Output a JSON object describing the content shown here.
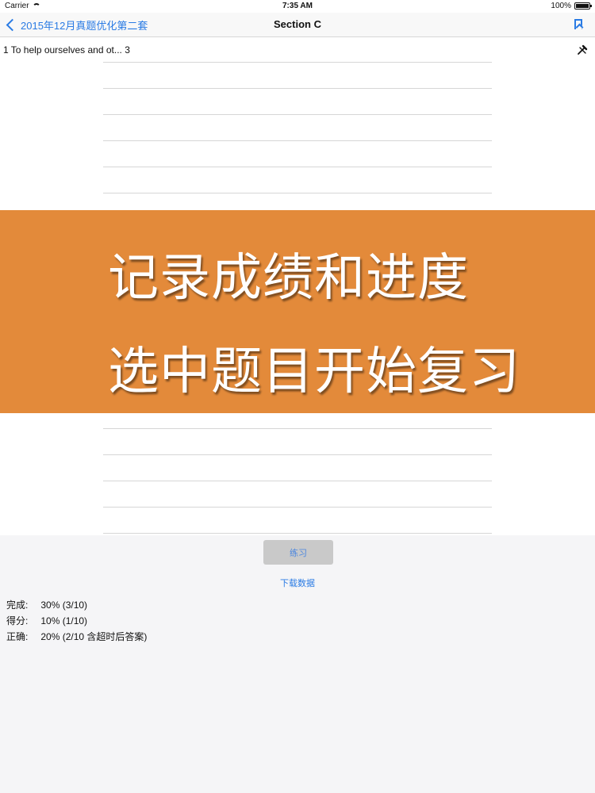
{
  "statusbar": {
    "carrier": "Carrier",
    "time": "7:35 AM",
    "battery": "100%",
    "battery_level": 1.0
  },
  "navbar": {
    "back_label": "2015年12月真题优化第二套",
    "title": "Section C"
  },
  "question": {
    "text": "1 To help ourselves and ot... 3"
  },
  "banner": {
    "line1": "记录成绩和进度",
    "line2": "选中题目开始复习",
    "color": "#e38a3a"
  },
  "actions": {
    "practice_label": "练习",
    "download_label": "下载数据"
  },
  "stats": [
    {
      "label": "完成:",
      "value": "30% (3/10)"
    },
    {
      "label": "得分:",
      "value": "10% (1/10)"
    },
    {
      "label": "正确:",
      "value": "20% (2/10 含超时后答案)"
    }
  ],
  "icons": {
    "back": "chevron-left-icon",
    "bookmark": "bookmark-icon",
    "tool": "tools-icon",
    "wifi": "wifi-icon",
    "battery": "battery-icon"
  },
  "colors": {
    "accent": "#2a7be4",
    "banner": "#e38a3a"
  }
}
